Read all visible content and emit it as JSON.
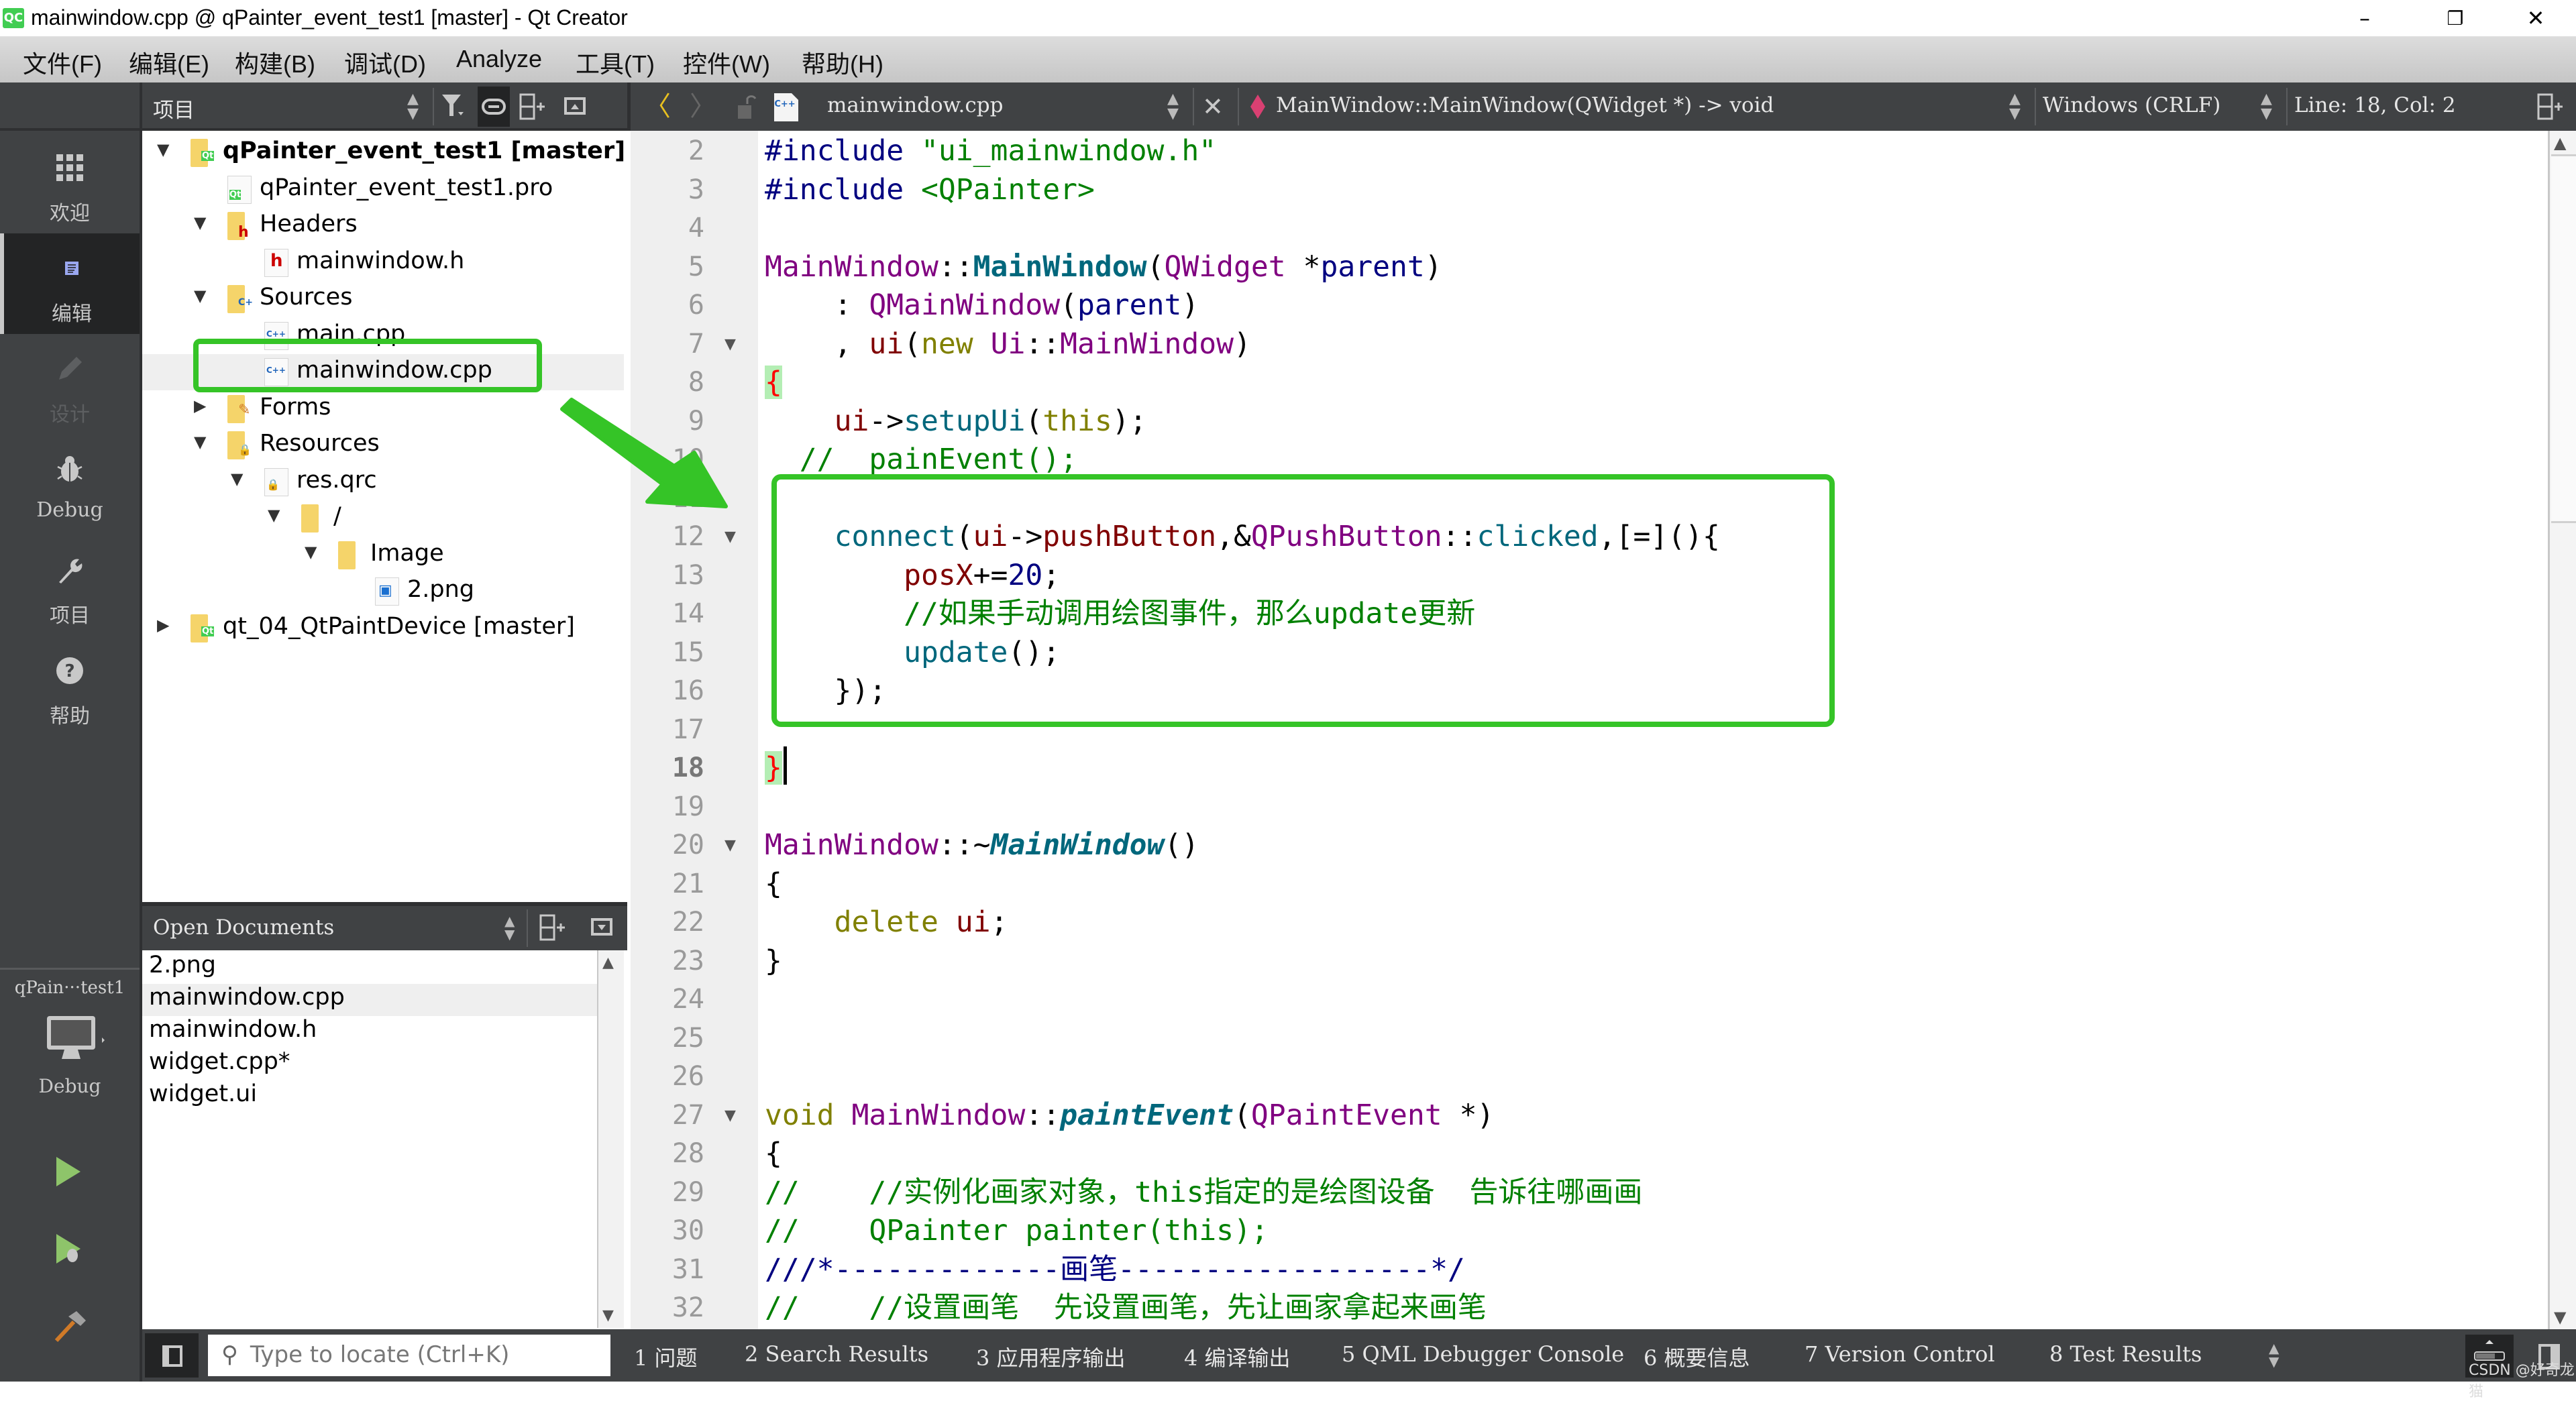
{
  "window": {
    "title": "mainwindow.cpp @ qPainter_event_test1 [master] - Qt Creator",
    "app_icon": "QC",
    "minimize": "–",
    "maximize": "❐",
    "close": "✕"
  },
  "menu": [
    "文件(F)",
    "编辑(E)",
    "构建(B)",
    "调试(D)",
    "Analyze",
    "工具(T)",
    "控件(W)",
    "帮助(H)"
  ],
  "modes": [
    {
      "label": "欢迎",
      "icon": "grid-icon"
    },
    {
      "label": "编辑",
      "icon": "edit-doc-icon",
      "active": true
    },
    {
      "label": "设计",
      "icon": "pencil-icon",
      "disabled": true
    },
    {
      "label": "Debug",
      "icon": "bug-icon"
    },
    {
      "label": "项目",
      "icon": "wrench-icon"
    },
    {
      "label": "帮助",
      "icon": "help-icon"
    }
  ],
  "kit": {
    "project": "qPain···test1",
    "build": "Debug"
  },
  "project_panel": {
    "title": "项目",
    "tree": [
      {
        "label": "qPainter_event_test1 [master]",
        "level": 0,
        "expanded": true,
        "type": "project",
        "bold": true
      },
      {
        "label": "qPainter_event_test1.pro",
        "level": 1,
        "type": "pro"
      },
      {
        "label": "Headers",
        "level": 1,
        "expanded": true,
        "type": "folder-h"
      },
      {
        "label": "mainwindow.h",
        "level": 2,
        "type": "h"
      },
      {
        "label": "Sources",
        "level": 1,
        "expanded": true,
        "type": "folder-cpp"
      },
      {
        "label": "main.cpp",
        "level": 2,
        "type": "cpp"
      },
      {
        "label": "mainwindow.cpp",
        "level": 2,
        "type": "cpp",
        "selected": true
      },
      {
        "label": "Forms",
        "level": 1,
        "expanded": false,
        "type": "folder-forms"
      },
      {
        "label": "Resources",
        "level": 1,
        "expanded": true,
        "type": "folder-res"
      },
      {
        "label": "res.qrc",
        "level": 2,
        "expanded": true,
        "type": "qrc"
      },
      {
        "label": "/",
        "level": 3,
        "expanded": true,
        "type": "folder"
      },
      {
        "label": "Image",
        "level": 4,
        "expanded": true,
        "type": "folder"
      },
      {
        "label": "2.png",
        "level": 5,
        "type": "png"
      },
      {
        "label": "qt_04_QtPaintDevice [master]",
        "level": 0,
        "expanded": false,
        "type": "project"
      }
    ]
  },
  "open_documents": {
    "title": "Open Documents",
    "items": [
      "2.png",
      "mainwindow.cpp",
      "mainwindow.h",
      "widget.cpp*",
      "widget.ui"
    ],
    "selected_index": 1
  },
  "editor_toolbar": {
    "file": "mainwindow.cpp",
    "symbol": "MainWindow::MainWindow(QWidget *) -> void",
    "line_ending": "Windows (CRLF)",
    "position": "Line: 18, Col: 2"
  },
  "editor": {
    "current_line": 18,
    "fold_lines": [
      7,
      12,
      20,
      27
    ],
    "lines": [
      {
        "n": 2,
        "tokens": [
          [
            "pp",
            "#include "
          ],
          [
            "str",
            "\"ui_mainwindow.h\""
          ]
        ]
      },
      {
        "n": 3,
        "tokens": [
          [
            "pp",
            "#include "
          ],
          [
            "str",
            "<QPainter>"
          ]
        ]
      },
      {
        "n": 4,
        "tokens": []
      },
      {
        "n": 5,
        "tokens": [
          [
            "ty",
            "MainWindow"
          ],
          [
            "",
            "::"
          ],
          [
            "fnb",
            "MainWindow"
          ],
          [
            "",
            "("
          ],
          [
            "ty",
            "QWidget"
          ],
          [
            "",
            " *"
          ],
          [
            "dx",
            "parent"
          ],
          [
            "",
            ")"
          ]
        ]
      },
      {
        "n": 6,
        "tokens": [
          [
            "",
            "    : "
          ],
          [
            "ty",
            "QMainWindow"
          ],
          [
            "",
            "("
          ],
          [
            "dx",
            "parent"
          ],
          [
            "",
            ")"
          ]
        ]
      },
      {
        "n": 7,
        "tokens": [
          [
            "",
            "    , "
          ],
          [
            "mem",
            "ui"
          ],
          [
            "",
            "("
          ],
          [
            "kw",
            "new"
          ],
          [
            "",
            " "
          ],
          [
            "ty",
            "Ui"
          ],
          [
            "",
            "::"
          ],
          [
            "ty",
            "MainWindow"
          ],
          [
            "",
            ")"
          ]
        ]
      },
      {
        "n": 8,
        "tokens": [
          [
            "brace",
            "{"
          ]
        ]
      },
      {
        "n": 9,
        "tokens": [
          [
            "",
            "    "
          ],
          [
            "mem",
            "ui"
          ],
          [
            "",
            "->"
          ],
          [
            "fn",
            "setupUi"
          ],
          [
            "",
            "("
          ],
          [
            "kw",
            "this"
          ],
          [
            "",
            ");"
          ]
        ]
      },
      {
        "n": 10,
        "tokens": [
          [
            "cm",
            "  //  painEvent();"
          ]
        ]
      },
      {
        "n": 11,
        "tokens": []
      },
      {
        "n": 12,
        "tokens": [
          [
            "",
            "    "
          ],
          [
            "fn",
            "connect"
          ],
          [
            "",
            "("
          ],
          [
            "mem",
            "ui"
          ],
          [
            "",
            "->"
          ],
          [
            "mem",
            "pushButton"
          ],
          [
            "",
            ",&"
          ],
          [
            "ty",
            "QPushButton"
          ],
          [
            "",
            "::"
          ],
          [
            "fn",
            "clicked"
          ],
          [
            "",
            ",[=](){"
          ]
        ]
      },
      {
        "n": 13,
        "tokens": [
          [
            "",
            "        "
          ],
          [
            "mem",
            "posX"
          ],
          [
            "",
            "+="
          ],
          [
            "num",
            "20"
          ],
          [
            "",
            ";"
          ]
        ]
      },
      {
        "n": 14,
        "tokens": [
          [
            "cm",
            "        //如果手动调用绘图事件，那么update更新"
          ]
        ]
      },
      {
        "n": 15,
        "tokens": [
          [
            "",
            "        "
          ],
          [
            "fn",
            "update"
          ],
          [
            "",
            "();"
          ]
        ]
      },
      {
        "n": 16,
        "tokens": [
          [
            "",
            "    });"
          ]
        ]
      },
      {
        "n": 17,
        "tokens": []
      },
      {
        "n": 18,
        "tokens": [
          [
            "brace",
            "}"
          ]
        ]
      },
      {
        "n": 19,
        "tokens": []
      },
      {
        "n": 20,
        "tokens": [
          [
            "ty",
            "MainWindow"
          ],
          [
            "",
            "::~"
          ],
          [
            "fni",
            "MainWindow"
          ],
          [
            "",
            "()"
          ]
        ]
      },
      {
        "n": 21,
        "tokens": [
          [
            "",
            "{"
          ]
        ]
      },
      {
        "n": 22,
        "tokens": [
          [
            "",
            "    "
          ],
          [
            "kw",
            "delete"
          ],
          [
            "",
            " "
          ],
          [
            "mem",
            "ui"
          ],
          [
            "",
            ";"
          ]
        ]
      },
      {
        "n": 23,
        "tokens": [
          [
            "",
            "}"
          ]
        ]
      },
      {
        "n": 24,
        "tokens": []
      },
      {
        "n": 25,
        "tokens": []
      },
      {
        "n": 26,
        "tokens": []
      },
      {
        "n": 27,
        "tokens": [
          [
            "kw",
            "void"
          ],
          [
            "",
            " "
          ],
          [
            "ty",
            "MainWindow"
          ],
          [
            "",
            "::"
          ],
          [
            "fni",
            "paintEvent"
          ],
          [
            "",
            "("
          ],
          [
            "ty",
            "QPaintEvent"
          ],
          [
            "",
            " *)"
          ]
        ]
      },
      {
        "n": 28,
        "tokens": [
          [
            "",
            "{"
          ]
        ]
      },
      {
        "n": 29,
        "tokens": [
          [
            "cm",
            "//    //实例化画家对象，this指定的是绘图设备  告诉往哪画画"
          ]
        ]
      },
      {
        "n": 30,
        "tokens": [
          [
            "cm",
            "//    QPainter painter(this);"
          ]
        ]
      },
      {
        "n": 31,
        "tokens": [
          [
            "pp",
            "///*-------------画笔------------------*/"
          ]
        ]
      },
      {
        "n": 32,
        "tokens": [
          [
            "cm",
            "//    //设置画笔  先设置画笔，先让画家拿起来画笔"
          ]
        ]
      }
    ]
  },
  "output_panes": [
    "1 问题",
    "2 Search Results",
    "3 应用程序输出",
    "4 编译输出",
    "5 QML Debugger Console",
    "6 概要信息",
    "7 Version Control",
    "8 Test Results"
  ],
  "locator": {
    "placeholder": "Type to locate (Ctrl+K)"
  },
  "watermark": "CSDN @好奇龙猫",
  "colors": {
    "annotation": "#35c427",
    "accent_bracket_bg": "#b4eeb4"
  }
}
